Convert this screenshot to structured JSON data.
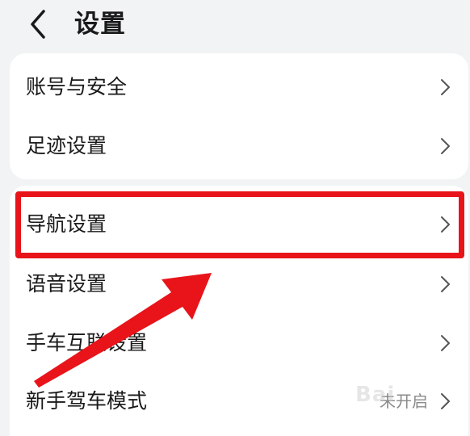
{
  "header": {
    "title": "设置"
  },
  "groups": [
    {
      "items": [
        {
          "label": "账号与安全"
        },
        {
          "label": "足迹设置"
        }
      ]
    },
    {
      "items": [
        {
          "label": "导航设置"
        },
        {
          "label": "语音设置"
        },
        {
          "label": "手车互联设置"
        },
        {
          "label": "新手驾车模式",
          "value": "未开启"
        }
      ]
    }
  ],
  "annotation": {
    "highlight_color": "#e8141a",
    "highlighted_item": "导航设置"
  },
  "watermark": "Bai"
}
